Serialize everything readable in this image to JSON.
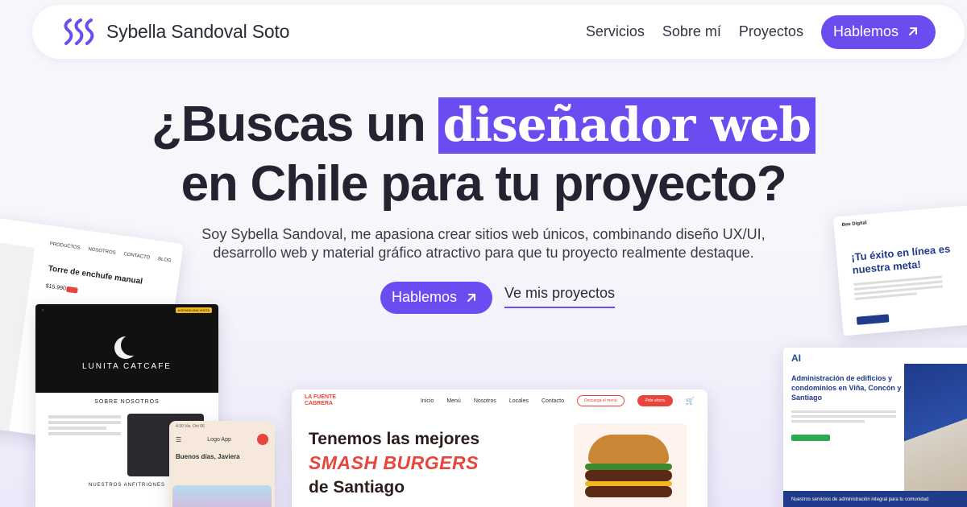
{
  "nav": {
    "brand_name": "Sybella Sandoval Soto",
    "links": [
      "Servicios",
      "Sobre mí",
      "Proyectos"
    ],
    "cta_label": "Hablemos"
  },
  "hero": {
    "title_before": "¿Buscas un ",
    "title_highlight": "diseñador web",
    "title_line2": "en Chile para tu proyecto?",
    "subtitle": "Soy Sybella Sandoval, me apasiona crear sitios web únicos, combinando diseño UX/UI, desarrollo web y material gráfico atractivo para que tu proyecto realmente destaque.",
    "cta_primary": "Hablemos",
    "cta_secondary": "Ve mis proyectos"
  },
  "mockups": {
    "shop": {
      "menu": [
        "PRODUCTOS",
        "NOSOTROS",
        "CONTACTO",
        "BLOG"
      ],
      "product_title": "Torre de enchufe manual",
      "price": "$15.990"
    },
    "lunita": {
      "badge": "AGENDA UNA VISITA",
      "name": "LUNITA CATCAFE",
      "section_about": "SOBRE NOSOTROS",
      "section_team": "NUESTROS ANFITRIONES"
    },
    "phone": {
      "status": "4:30 Vie, Oct 06",
      "logo": "Logo App",
      "greeting": "Buenos días, Javiera"
    },
    "fuente": {
      "logo": "LA FUENTE CABRERA",
      "links": [
        "Inicio",
        "Menú",
        "Nosotros",
        "Locales",
        "Contacto"
      ],
      "btn_outline": "Descarga el menú",
      "btn_fill": "Pide ahora",
      "line1": "Tenemos las mejores",
      "line2": "SMASH BURGERS",
      "line3": "de Santiago"
    },
    "bee": {
      "logo": "Bee Digital",
      "title": "¡Tu éxito en línea es nuestra meta!"
    },
    "admin": {
      "title": "Administración de edificios y condominios en Viña, Concón y Santiago",
      "footer": "Nuestros servicios de administración integral para tu comunidad"
    }
  },
  "colors": {
    "accent": "#6a4cf0",
    "burger_red": "#e8453c",
    "navy": "#1f3b8a"
  }
}
